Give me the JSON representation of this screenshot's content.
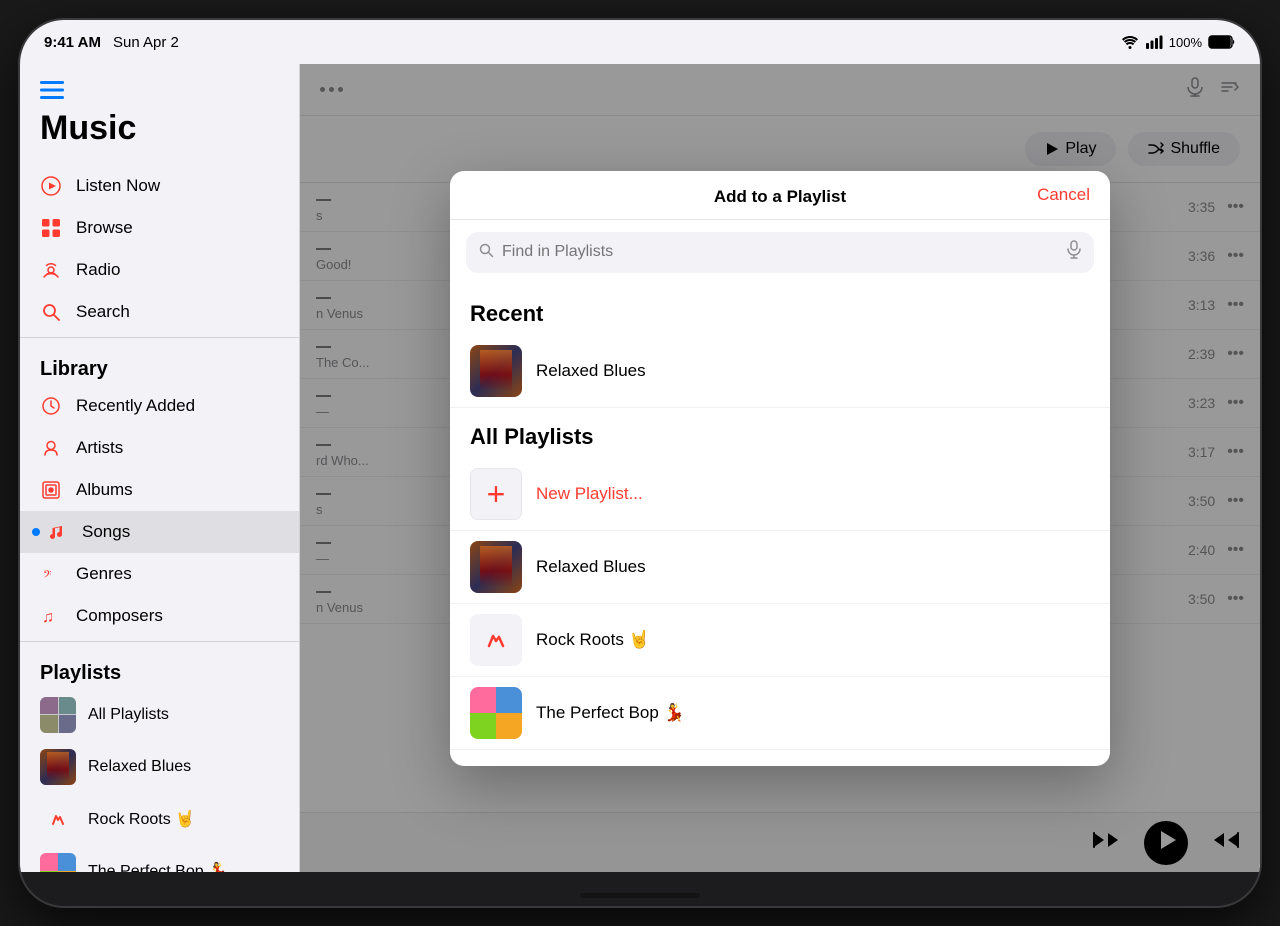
{
  "status_bar": {
    "time": "9:41 AM",
    "date": "Sun Apr 2",
    "battery": "100%"
  },
  "sidebar": {
    "title": "Music",
    "nav_items": [
      {
        "id": "listen-now",
        "label": "Listen Now",
        "icon": "play-circle"
      },
      {
        "id": "browse",
        "label": "Browse",
        "icon": "grid"
      },
      {
        "id": "radio",
        "label": "Radio",
        "icon": "radio"
      },
      {
        "id": "search",
        "label": "Search",
        "icon": "search"
      }
    ],
    "library_header": "Library",
    "library_items": [
      {
        "id": "recently-added",
        "label": "Recently Added",
        "icon": "clock"
      },
      {
        "id": "artists",
        "label": "Artists",
        "icon": "mic"
      },
      {
        "id": "albums",
        "label": "Albums",
        "icon": "album"
      },
      {
        "id": "songs",
        "label": "Songs",
        "icon": "music-note",
        "active": true
      },
      {
        "id": "genres",
        "label": "Genres",
        "icon": "genres"
      },
      {
        "id": "composers",
        "label": "Composers",
        "icon": "composers"
      }
    ],
    "playlists_header": "Playlists",
    "playlist_items": [
      {
        "id": "all-playlists",
        "label": "All Playlists",
        "thumb": "grid"
      },
      {
        "id": "relaxed-blues",
        "label": "Relaxed Blues",
        "thumb": "blues"
      },
      {
        "id": "rock-roots",
        "label": "Rock Roots 🤘",
        "thumb": "rock"
      },
      {
        "id": "the-perfect-bop",
        "label": "The Perfect Bop 💃",
        "thumb": "bop"
      }
    ]
  },
  "main_panel": {
    "songs": [
      {
        "title": "...",
        "artist": "...",
        "duration": "3:35"
      },
      {
        "title": "...",
        "artist": "Good!",
        "duration": "3:36"
      },
      {
        "title": "...",
        "artist": "n Venus",
        "duration": "3:13"
      },
      {
        "title": "...",
        "artist": "The Co...",
        "duration": "2:39"
      },
      {
        "title": "...",
        "artist": "...",
        "duration": "3:23"
      },
      {
        "title": "...",
        "artist": "rd Who...",
        "duration": "3:17"
      },
      {
        "title": "...",
        "artist": "...",
        "duration": "3:50"
      },
      {
        "title": "...",
        "artist": "...",
        "duration": "2:40"
      },
      {
        "title": "...",
        "artist": "n Venus",
        "duration": "3:50"
      }
    ],
    "play_btn": "Play",
    "shuffle_btn": "Shuffle"
  },
  "modal": {
    "title": "Add to a Playlist",
    "cancel_label": "Cancel",
    "search_placeholder": "Find in Playlists",
    "recent_section": "Recent",
    "all_playlists_section": "All Playlists",
    "new_playlist_label": "New Playlist...",
    "playlists": [
      {
        "id": "relaxed-blues-recent",
        "label": "Relaxed Blues",
        "thumb": "blues"
      },
      {
        "id": "new-playlist",
        "label": "New Playlist...",
        "thumb": "new"
      },
      {
        "id": "relaxed-blues-all",
        "label": "Relaxed Blues",
        "thumb": "blues"
      },
      {
        "id": "rock-roots-all",
        "label": "Rock Roots 🤘",
        "thumb": "rock"
      },
      {
        "id": "the-perfect-bop-all",
        "label": "The Perfect Bop 💃",
        "thumb": "bop"
      }
    ]
  }
}
